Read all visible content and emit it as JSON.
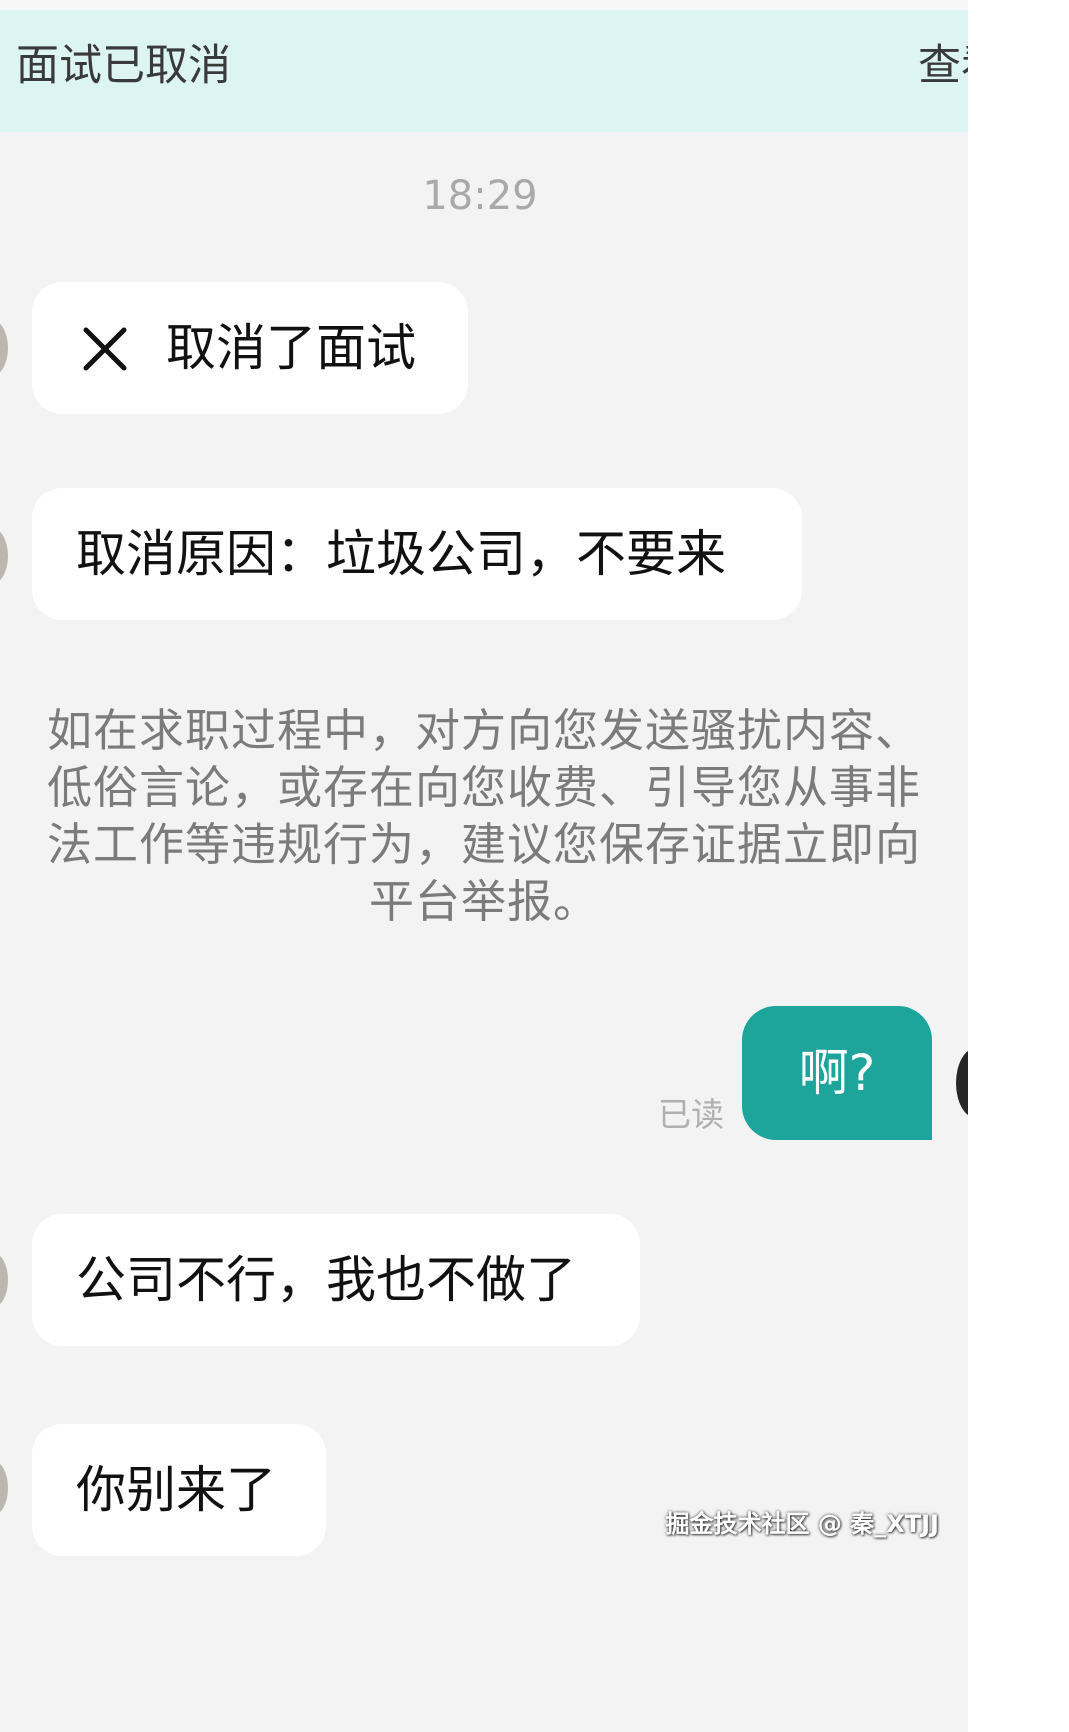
{
  "banner": {
    "title": "面试已取消",
    "action_label": "查看"
  },
  "timestamp": "18:29",
  "messages": [
    {
      "sender": "other",
      "text": "取消了面试",
      "icon": "close-icon"
    },
    {
      "sender": "other",
      "text": "取消原因：垃圾公司，不要来"
    },
    {
      "sender": "self",
      "text": "啊?",
      "status": "已读"
    },
    {
      "sender": "other",
      "text": "公司不行，我也不做了"
    },
    {
      "sender": "other",
      "text": "你别来了"
    }
  ],
  "system_notice": "如在求职过程中，对方向您发送骚扰内容、低俗言论，或存在向您收费、引导您从事非法工作等违规行为，建议您保存证据立即向平台举报。",
  "watermark": "掘金技术社区 @ 秦_XTJJ",
  "colors": {
    "banner_bg": "#dcf4f2",
    "chat_bg": "#f3f3f3",
    "self_bubble": "#1da59c",
    "other_bubble": "#ffffff"
  }
}
